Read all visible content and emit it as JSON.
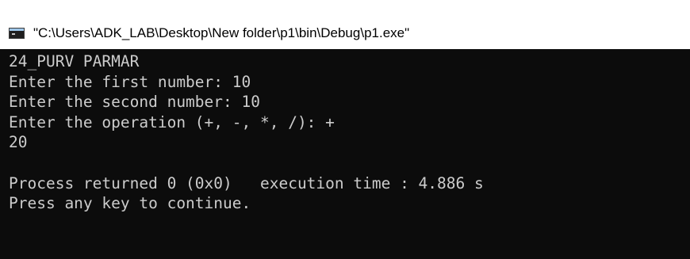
{
  "window": {
    "title": "\"C:\\Users\\ADK_LAB\\Desktop\\New folder\\p1\\bin\\Debug\\p1.exe\"",
    "icon": "console-app-icon"
  },
  "console": {
    "lines": [
      "24_PURV PARMAR",
      "Enter the first number: 10",
      "Enter the second number: 10",
      "Enter the operation (+, -, *, /): +",
      "20",
      "",
      "Process returned 0 (0x0)   execution time : 4.886 s",
      "Press any key to continue."
    ]
  },
  "colors": {
    "console_background": "#0c0c0c",
    "console_text": "#cccccc",
    "titlebar_background": "#ffffff",
    "titlebar_text": "#000000"
  }
}
